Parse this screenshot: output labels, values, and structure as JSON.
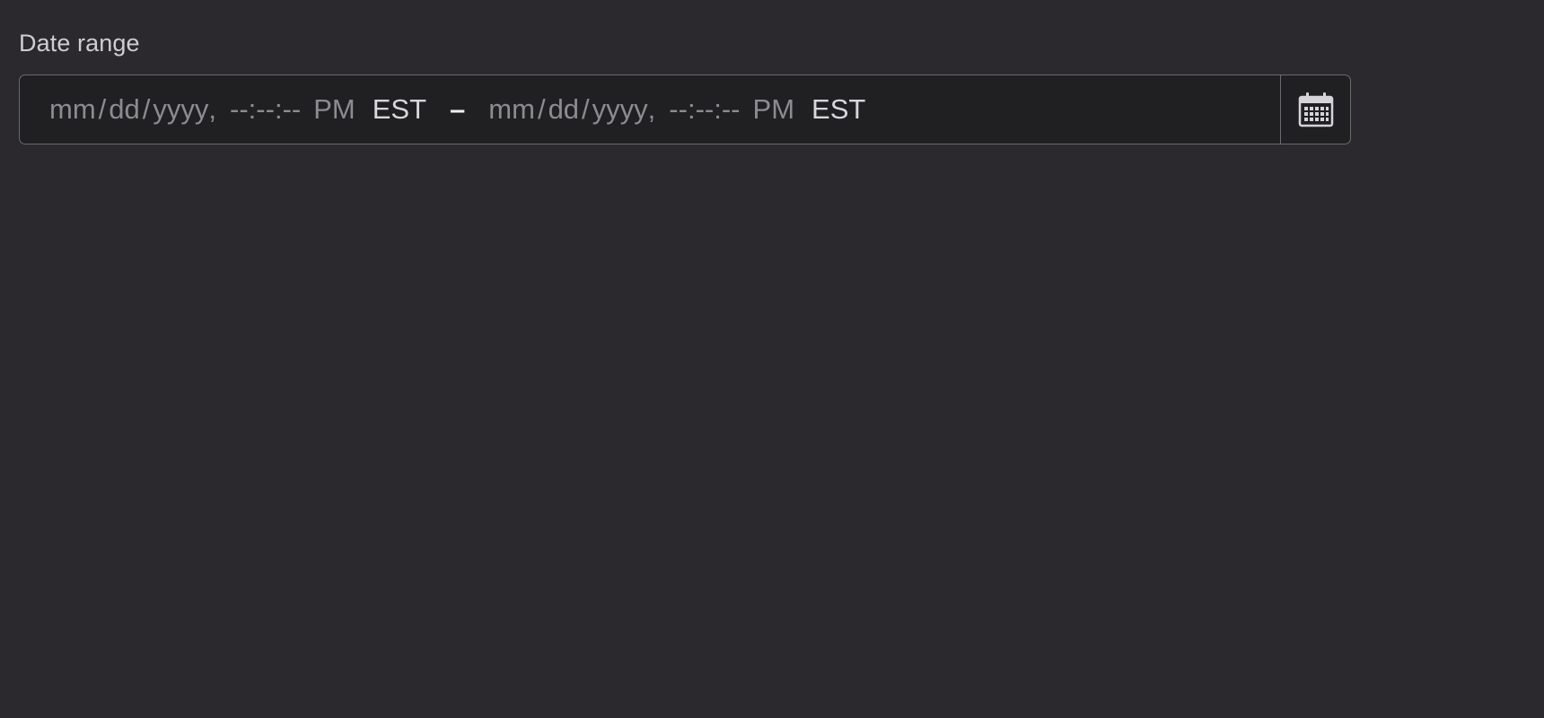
{
  "field": {
    "label": "Date range"
  },
  "start": {
    "month": "mm",
    "day": "dd",
    "year": "yyyy",
    "hour": "--",
    "minute": "--",
    "second": "--",
    "ampm": "PM",
    "timezone": "EST"
  },
  "separators": {
    "date": "/",
    "comma": ",",
    "time": ":",
    "range": "–"
  },
  "end": {
    "month": "mm",
    "day": "dd",
    "year": "yyyy",
    "hour": "--",
    "minute": "--",
    "second": "--",
    "ampm": "PM",
    "timezone": "EST"
  },
  "icons": {
    "calendar": "calendar-icon"
  }
}
